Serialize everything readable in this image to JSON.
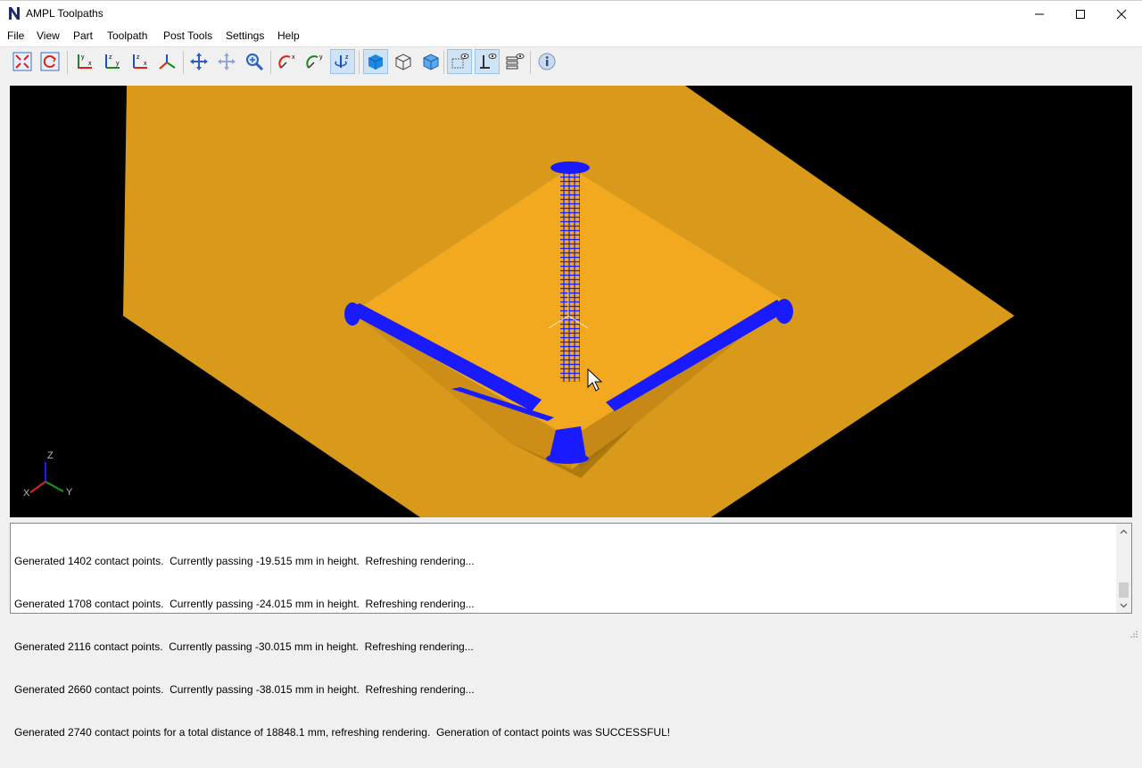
{
  "window": {
    "title": "AMPL Toolpaths",
    "logo_icon": "app-logo-icon",
    "controls": [
      "minimize-icon",
      "maximize-icon",
      "close-icon"
    ]
  },
  "menu": {
    "file": "File",
    "view": "View",
    "part": "Part",
    "toolpath": "Toolpath",
    "post_tools": "Post Tools",
    "settings": "Settings",
    "help": "Help"
  },
  "toolbar": {
    "buttons": [
      {
        "icon": "fit-all-icon",
        "active": false
      },
      {
        "icon": "reset-view-icon",
        "active": false
      },
      {
        "icon": "view-xy-icon",
        "active": false
      },
      {
        "icon": "view-yz-icon",
        "active": false
      },
      {
        "icon": "view-zx-icon",
        "active": false
      },
      {
        "icon": "view-iso-icon",
        "active": false
      },
      {
        "icon": "pan-icon",
        "active": false
      },
      {
        "icon": "rotate-pan-icon",
        "active": false
      },
      {
        "icon": "zoom-icon",
        "active": false
      },
      {
        "icon": "rotate-x-icon",
        "active": false
      },
      {
        "icon": "rotate-y-icon",
        "active": false
      },
      {
        "icon": "rotate-z-icon",
        "active": true
      },
      {
        "icon": "shaded-solid-icon",
        "active": true
      },
      {
        "icon": "wireframe-icon",
        "active": false
      },
      {
        "icon": "transparent-solid-icon",
        "active": false
      },
      {
        "icon": "show-points-icon",
        "active": true
      },
      {
        "icon": "show-normals-icon",
        "active": true
      },
      {
        "icon": "show-layers-icon",
        "active": false
      },
      {
        "icon": "info-icon",
        "active": false
      }
    ]
  },
  "viewport": {
    "background": "#000000",
    "part_color": "#d99a1c",
    "toolpath_color": "#1a1aff",
    "axis_triad": {
      "z": "Z",
      "x": "X",
      "y": "Y"
    }
  },
  "log": {
    "lines": [
      "Generated 1402 contact points.  Currently passing -19.515 mm in height.  Refreshing rendering...",
      "Generated 1708 contact points.  Currently passing -24.015 mm in height.  Refreshing rendering...",
      "Generated 2116 contact points.  Currently passing -30.015 mm in height.  Refreshing rendering...",
      "Generated 2660 contact points.  Currently passing -38.015 mm in height.  Refreshing rendering...",
      "Generated 2740 contact points for a total distance of 18848.1 mm, refreshing rendering.  Generation of contact points was SUCCESSFUL!"
    ]
  }
}
